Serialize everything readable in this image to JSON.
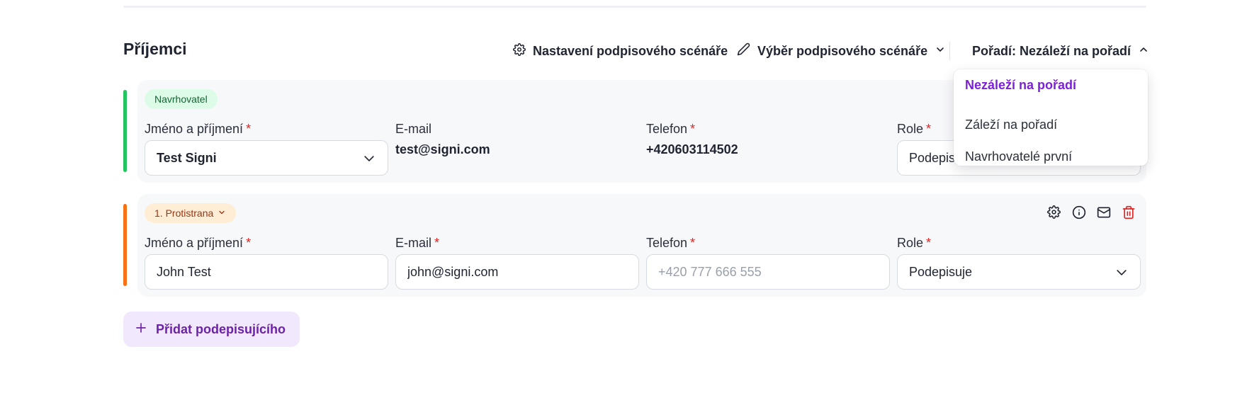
{
  "header": {
    "title": "Příjemci",
    "settings_label": "Nastavení podpisového scénáře",
    "select_label": "Výběr podpisového scénáře",
    "order_label": "Pořadí: Nezáleží na pořadí"
  },
  "order_dropdown": {
    "options": [
      "Nezáleží na pořadí",
      "Záleží na pořadí",
      "Navrhovatelé první"
    ],
    "selected": "Nezáleží na pořadí"
  },
  "recipients": [
    {
      "badge": "Navrhovatel",
      "name_label": "Jméno a příjmení",
      "name_value": "Test Signi",
      "email_label": "E-mail",
      "email_value": "test@signi.com",
      "phone_label": "Telefon",
      "phone_value": "+420603114502",
      "role_label": "Role",
      "role_value": "Podepisuje"
    },
    {
      "badge": "1. Protistrana",
      "name_label": "Jméno a příjmení",
      "name_value": "John Test",
      "email_label": "E-mail",
      "email_value": "john@signi.com",
      "phone_label": "Telefon",
      "phone_placeholder": "+420 777 666 555",
      "role_label": "Role",
      "role_value": "Podepisuje"
    }
  ],
  "required_mark": "*",
  "add_button_label": "Přidat podepisujícího",
  "colors": {
    "accent_proposer": "#22c55e",
    "accent_counterparty": "#f97316",
    "selected_option": "#7c22d6",
    "required": "#dc2626",
    "delete_icon": "#dc2626"
  },
  "icons": [
    "gear-icon",
    "pencil-icon",
    "chevron-down-icon",
    "chevron-up-icon",
    "info-icon",
    "mail-icon",
    "trash-icon",
    "plus-icon"
  ]
}
